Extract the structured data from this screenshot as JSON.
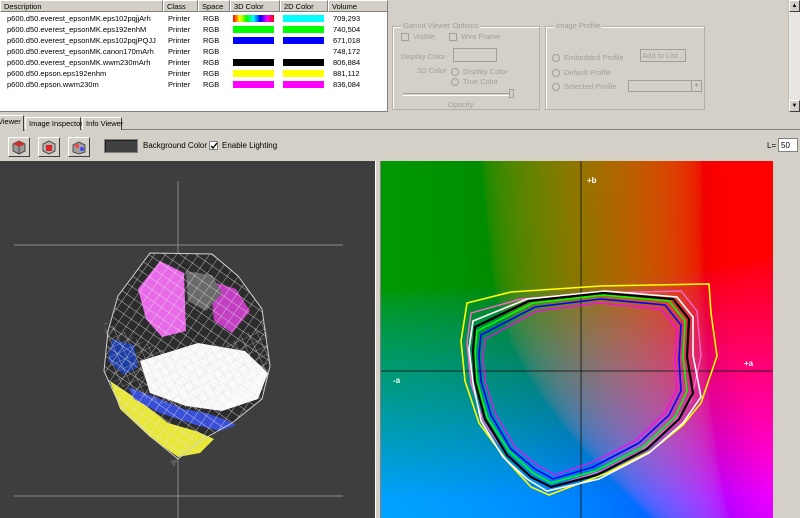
{
  "table": {
    "headers": [
      "Description",
      "Class",
      "Space",
      "3D Color",
      "2D Color",
      "Volume"
    ],
    "rows": [
      {
        "description": "p600.d50.everest_epsonMK.eps102pqjjArh",
        "class": "Printer",
        "space": "RGB",
        "color3d": "spectrum",
        "color2d": "#00ffff",
        "volume": "709,293"
      },
      {
        "description": "p600.d50.everest_epsonMK.eps192enhM",
        "class": "Printer",
        "space": "RGB",
        "color3d": "#00ff00",
        "color2d": "#00ff00",
        "volume": "740,504"
      },
      {
        "description": "p600.d50.everest_epsonMK.eps102pqjPQJJ",
        "class": "Printer",
        "space": "RGB",
        "color3d": "#0000ff",
        "color2d": "#0000ff",
        "volume": "671,018"
      },
      {
        "description": "p600.d50.everest_epsonMK.canon170mArh",
        "class": "Printer",
        "space": "RGB",
        "color3d": "",
        "color2d": "",
        "volume": "748,172"
      },
      {
        "description": "p600.d50.everest_epsonMK.wwm230mArh",
        "class": "Printer",
        "space": "RGB",
        "color3d": "#000000",
        "color2d": "#000000",
        "volume": "806,884"
      },
      {
        "description": "p600.d50.epson.eps192enhm",
        "class": "Printer",
        "space": "RGB",
        "color3d": "#ffff00",
        "color2d": "#ffff00",
        "volume": "881,112"
      },
      {
        "description": "p600.d50.epson.wwm230m",
        "class": "Printer",
        "space": "RGB",
        "color3d": "#ff00ff",
        "color2d": "#ff00ff",
        "volume": "836,084"
      }
    ]
  },
  "gamut_options": {
    "title": "Gamut Viewer Options",
    "visible_label": "Visible",
    "wireframe_label": "Wire Frame",
    "display_color_label": "Display Color",
    "color3d_label": "3D Color",
    "opt_display_color": "Display Color",
    "opt_true_color": "True Color",
    "opacity_label": "Opacity"
  },
  "image_profile": {
    "title": "Image Profile",
    "embedded_label": "Embedded Profile",
    "default_label": "Default Profile",
    "selected_label": "Selected Profile",
    "add_button": "Add to List..."
  },
  "tabs": [
    {
      "label": "Viewer",
      "active": true
    },
    {
      "label": "Image Inspector",
      "active": false
    },
    {
      "label": "Info Viewer",
      "active": false
    }
  ],
  "toolbar": {
    "buttons": [
      "cube-icon",
      "cube-red-icon",
      "lights-icon"
    ],
    "background_color_label": "Background Color",
    "background_color": "#404040",
    "enable_lighting_label": "Enable Lighting",
    "enable_lighting_checked": true,
    "l_label": "L=",
    "l_value": "50"
  },
  "ab_plot": {
    "plus_b_label": "+b",
    "plus_a_label": "+a",
    "minus_a_label": "-a",
    "outline_colors": [
      "#ffff00",
      "#ff66cc",
      "#ffffff",
      "#000000",
      "#00ff00",
      "#0000ff",
      "#ff00ff"
    ]
  }
}
